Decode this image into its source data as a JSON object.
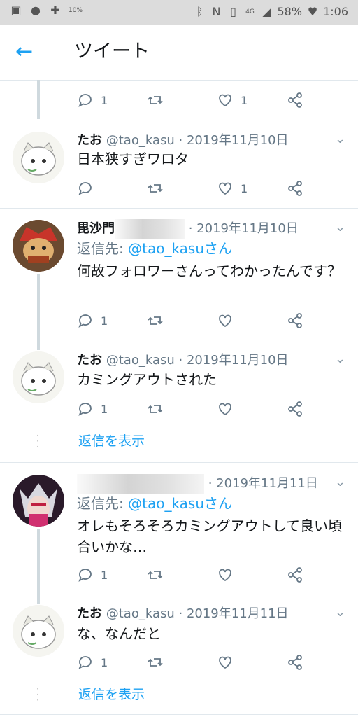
{
  "status_bar": {
    "extra": "10%",
    "battery": "58%",
    "time": "1:06"
  },
  "header": {
    "title": "ツイート"
  },
  "top_actions": {
    "reply_count": "1",
    "like_count": "1"
  },
  "tweets": [
    {
      "name": "たお",
      "handle": "@tao_kasu",
      "date": "· 2019年11月10日",
      "text": "日本狭すぎワロタ",
      "reply_count": "",
      "like_count": "1"
    },
    {
      "name": "毘沙門",
      "handle": "",
      "date": "· 2019年11月10日",
      "reply_prefix": "返信先:",
      "reply_to": "@tao_kasuさん",
      "text": "何故フォロワーさんってわかったんです？",
      "reply_count": "1",
      "like_count": ""
    },
    {
      "name": "たお",
      "handle": "@tao_kasu",
      "date": "· 2019年11月10日",
      "text": "カミングアウトされた",
      "reply_count": "1",
      "like_count": ""
    },
    {
      "name": "",
      "handle": "",
      "date": "· 2019年11月11日",
      "reply_prefix": "返信先:",
      "reply_to": "@tao_kasuさん",
      "text": "オレもそろそろカミングアウトして良い頃合いかな…",
      "reply_count": "1",
      "like_count": ""
    },
    {
      "name": "たお",
      "handle": "@tao_kasu",
      "date": "· 2019年11月11日",
      "text": "な、なんだと",
      "reply_count": "1",
      "like_count": ""
    }
  ],
  "show_replies_label": "返信を表示",
  "colors": {
    "accent": "#1da1f2",
    "muted": "#657786",
    "divider": "#e1e8ed"
  }
}
